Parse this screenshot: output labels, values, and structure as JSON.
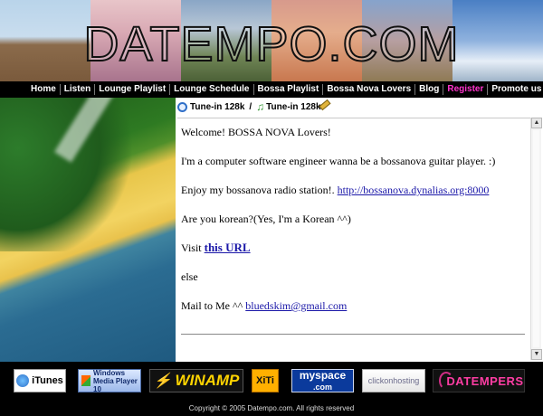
{
  "banner": {
    "title": "DATEMPO.COM"
  },
  "nav": {
    "items": [
      {
        "label": "Home"
      },
      {
        "label": "Listen"
      },
      {
        "label": "Lounge Playlist"
      },
      {
        "label": "Lounge Schedule"
      },
      {
        "label": "Bossa Playlist"
      },
      {
        "label": "Bossa Nova Lovers"
      },
      {
        "label": "Blog"
      },
      {
        "label": "Register",
        "highlight_color": "#ff33cc"
      },
      {
        "label": "Promote us"
      },
      {
        "label": "@"
      }
    ]
  },
  "tune_bar": {
    "link1_label": "Tune-in 128k",
    "separator": "/",
    "link2_label": "Tune-in 128k"
  },
  "content": {
    "welcome": "Welcome! BOSSA NOVA Lovers!",
    "intro": "I'm a computer software engineer wanna be a bossanova guitar player. :)",
    "enjoy_text": "Enjoy my bossanova radio station!. ",
    "enjoy_link": "http://bossanova.dynalias.org:8000",
    "korean_q": "Are you korean?(Yes, I'm a Korean ^^)",
    "visit_text": "Visit ",
    "visit_link": "this URL",
    "else_text": "else",
    "mail_text": "Mail to Me ^^ ",
    "mail_link": "bluedskim@gmail.com"
  },
  "logos": {
    "itunes": "iTunes",
    "wmp_line1": "Windows",
    "wmp_line2": "Media Player 10",
    "winamp": "WINAMP",
    "xiti": "XiTi",
    "myspace_line1": "myspace",
    "myspace_line2": ".com",
    "clickon": "clickonhosting",
    "datempers": "DATEMPERS"
  },
  "footer": {
    "copyright": "Copyright © 2005 Datempo.com. All rights reserved"
  },
  "icons": {
    "tune1_icon": "media-player-icon",
    "tune2_icon": "music-note-icon",
    "edit_icon": "pencil-icon"
  },
  "colors": {
    "nav_bg": "#000000",
    "link": "#1a17a8",
    "highlight": "#ff33cc"
  }
}
